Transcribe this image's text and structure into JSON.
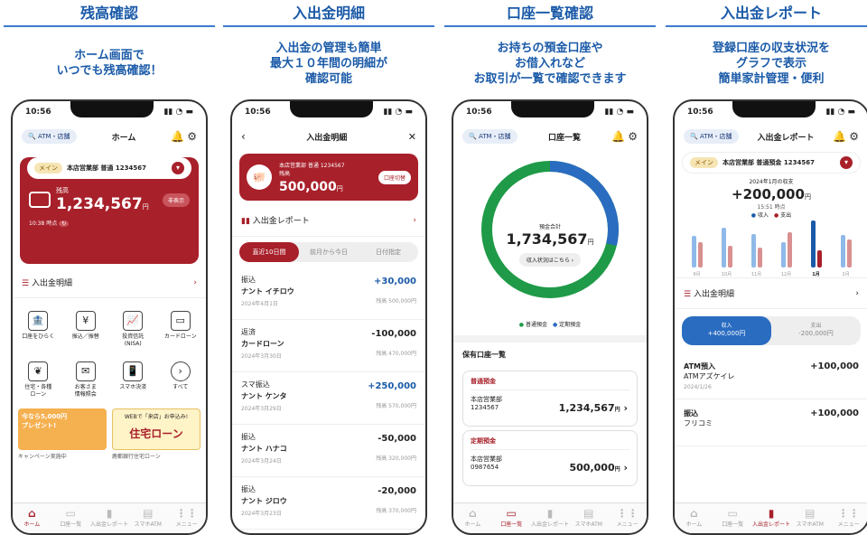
{
  "panels": [
    {
      "title": "残高確認",
      "subtitle": "ホーム画面で\nいつでも残高確認！"
    },
    {
      "title": "入出金明細",
      "subtitle": "入出金の管理も簡単\n最大１０年間の明細が\n確認可能"
    },
    {
      "title": "口座一覧確認",
      "subtitle": "お持ちの預金口座や\nお借入れなど\nお取引が一覧で確認できます"
    },
    {
      "title": "入出金レポート",
      "subtitle": "登録口座の収支状況を\nグラフで表示\n簡単家計管理・便利"
    }
  ],
  "status_time": "10:56",
  "atm_label": "ATM・店舗",
  "home": {
    "nav_title": "ホーム",
    "main_tag": "メイン",
    "account": "本店営業部 普通 1234567",
    "balance_label": "残高",
    "balance": "1,234,567",
    "yen": "円",
    "hide_label": "非表示",
    "time": "10:38 時点",
    "meisai": "入出金明細",
    "icons": [
      {
        "icon": "bank",
        "label": "口座をひらく"
      },
      {
        "icon": "transfer",
        "label": "振込／振替"
      },
      {
        "icon": "chart",
        "label": "投資信託\n(NISA)"
      },
      {
        "icon": "card",
        "label": "カードローン"
      },
      {
        "icon": "sprout",
        "label": "住宅・各種\nローン"
      },
      {
        "icon": "info",
        "label": "お客さま\n情報照会"
      },
      {
        "icon": "phone",
        "label": "スマホ決済"
      },
      {
        "icon": "more",
        "label": "すべて"
      }
    ],
    "promo1": "今なら5,000円\nプレゼント!",
    "promo1_caption": "キャンペーン実施中",
    "promo2_top": "WEBで「来店」お申込み!",
    "promo2": "住宅ローン",
    "promo2_caption": "鹿都銀行住宅ローン"
  },
  "detail": {
    "nav_title": "入出金明細",
    "account": "本店営業部 普通 1234567",
    "balance_label": "残高",
    "balance": "500,000",
    "yen": "円",
    "btn": "口座切替",
    "report": "入出金レポート",
    "tabs": [
      "直近10日間",
      "前月から今日",
      "日付指定"
    ],
    "tx": [
      {
        "type": "振込",
        "name": "ナント イチロウ",
        "date": "2024年4月1日",
        "amt": "+30,000",
        "bal": "残高 500,000円",
        "pos": true
      },
      {
        "type": "返済",
        "name": "カードローン",
        "date": "2024年3月30日",
        "amt": "-100,000",
        "bal": "残高 470,000円",
        "pos": false
      },
      {
        "type": "スマ振込",
        "name": "ナント ケンタ",
        "date": "2024年3月29日",
        "amt": "+250,000",
        "bal": "残高 570,000円",
        "pos": true
      },
      {
        "type": "振込",
        "name": "ナント ハナコ",
        "date": "2024年3月24日",
        "amt": "-50,000",
        "bal": "残高 320,000円",
        "pos": false
      },
      {
        "type": "振込",
        "name": "ナント ジロウ",
        "date": "2024年3月23日",
        "amt": "-20,000",
        "bal": "残高 370,000円",
        "pos": false
      }
    ]
  },
  "list": {
    "nav_title": "口座一覧",
    "total_label": "預金合計",
    "total": "1,734,567",
    "yen": "円",
    "status_btn": "収入状況はこちら",
    "legend": [
      "普通預金",
      "定期預金"
    ],
    "section": "保有口座一覧",
    "accounts": [
      {
        "kind": "普通預金",
        "branch": "本店営業部",
        "no": "1234567",
        "amt": "1,234,567"
      },
      {
        "kind": "定期預金",
        "branch": "本店営業部",
        "no": "0987654",
        "amt": "500,000"
      }
    ],
    "share_ordinary": 0.712,
    "share_time": 0.288
  },
  "report": {
    "nav_title": "入出金レポート",
    "main_tag": "メイン",
    "account": "本店営業部 普通預金 1234567",
    "period": "2024年1月の収支",
    "net": "+200,000",
    "yen": "円",
    "time": "15:51 時点",
    "legend": [
      "収入",
      "支出"
    ],
    "months": [
      "9月",
      "10月",
      "11月",
      "12月",
      "1月",
      "2月"
    ],
    "income": [
      0.62,
      0.78,
      0.66,
      0.5,
      0.92,
      0.64
    ],
    "expense": [
      0.5,
      0.42,
      0.4,
      0.7,
      0.34,
      0.56
    ],
    "meisai": "入出金明細",
    "seg": [
      {
        "l": "収入",
        "v": "+400,000円"
      },
      {
        "l": "支出",
        "v": "-200,000円"
      }
    ],
    "tx": [
      {
        "name": "ATM預入",
        "sub": "ATMアズケイレ",
        "date": "2024/1/26",
        "amt": "+100,000"
      },
      {
        "name": "振込",
        "sub": "フリコミ",
        "date": "",
        "amt": "+100,000"
      }
    ]
  },
  "tabbar": [
    "ホーム",
    "口座一覧",
    "入出金レポート",
    "スマホATM",
    "メニュー"
  ],
  "colors": {
    "accent": "#a8202a",
    "blue": "#1a5aa8",
    "green": "#1f9a48"
  }
}
